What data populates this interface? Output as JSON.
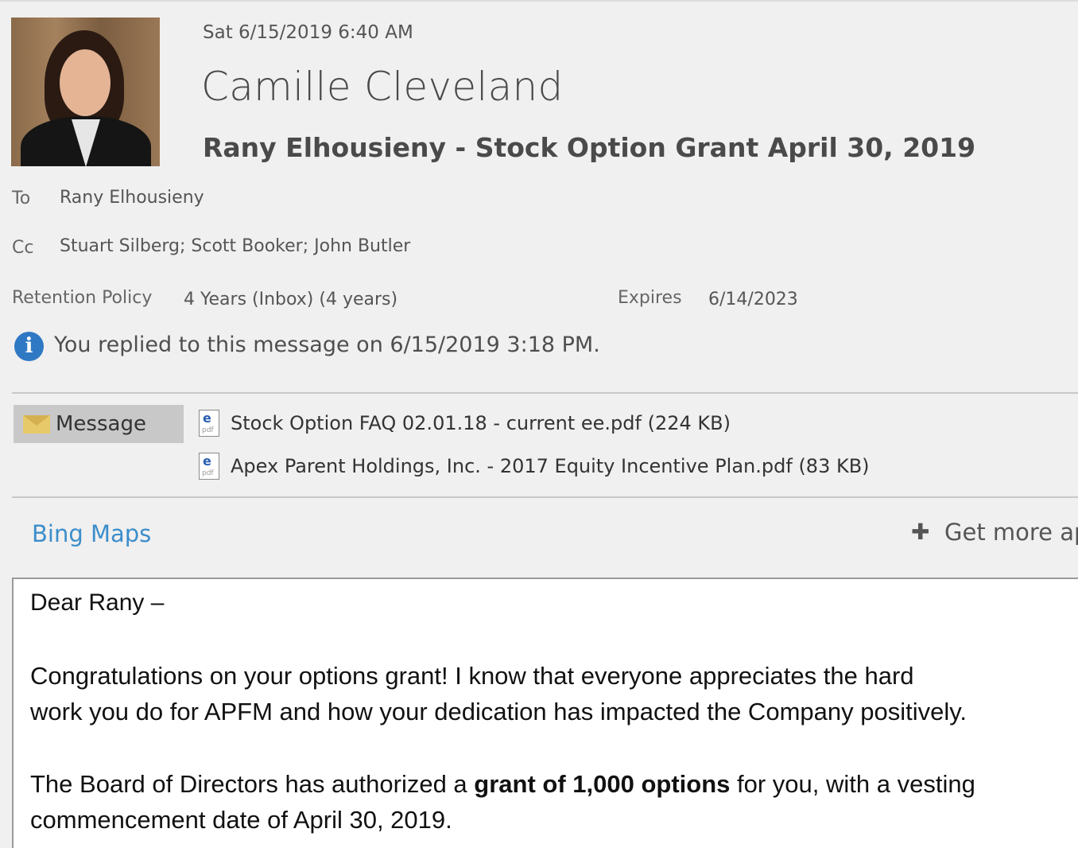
{
  "header": {
    "date": "Sat 6/15/2019 6:40 AM",
    "sender": "Camille Cleveland",
    "subject": "Rany Elhousieny - Stock Option Grant April 30, 2019"
  },
  "recipients": {
    "to_label": "To",
    "to_value": "Rany Elhousieny",
    "cc_label": "Cc",
    "cc_value": "Stuart Silberg; Scott Booker; John Butler"
  },
  "retention": {
    "policy_label": "Retention Policy",
    "policy_value": "4 Years (Inbox) (4 years)",
    "expires_label": "Expires",
    "expires_value": "6/14/2023"
  },
  "info_bar": {
    "icon": "info-icon",
    "text": "You replied to this message on 6/15/2019 3:18 PM."
  },
  "attachments_bar": {
    "message_tab": "Message",
    "attachments": [
      {
        "name": "Stock Option FAQ 02.01.18 - current ee.pdf",
        "size": "(224 KB)",
        "icon": "pdf-icon"
      },
      {
        "name": "Apex Parent Holdings, Inc. - 2017 Equity Incentive Plan.pdf",
        "size": "(83 KB)",
        "icon": "pdf-icon"
      }
    ]
  },
  "apps": {
    "bing_maps": "Bing Maps",
    "get_more": "Get more ap"
  },
  "body": {
    "greeting": "Dear Rany –",
    "para1_line1": "Congratulations on your options grant! I know that everyone appreciates the hard",
    "para1_line2": "work you do for APFM and how your dedication has impacted the Company positively.",
    "para2_line1_a": "The Board of Directors has authorized a ",
    "para2_line1_bold": "grant of 1,000 options",
    "para2_line1_b": " for you, with a vesting",
    "para2_line2": "commencement date of April 30, 2019."
  },
  "colors": {
    "background": "#f0f0f0",
    "link_blue": "#3c8ecb",
    "info_blue": "#2f78c4",
    "message_tab": "#c8c8c8"
  }
}
